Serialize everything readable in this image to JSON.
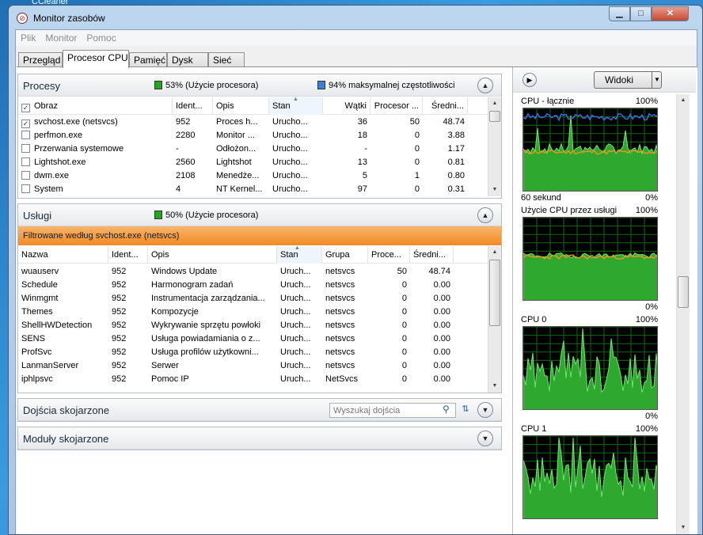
{
  "desktop_caption": "CCleaner",
  "window": {
    "title": "Monitor zasobów",
    "min_glyph": "▁",
    "max_glyph": "□",
    "close_glyph": "✕"
  },
  "menu": [
    "Plik",
    "Monitor",
    "Pomoc"
  ],
  "tabs": [
    "Przegląd",
    "Procesor CPU",
    "Pamięć",
    "Dysk",
    "Sieć"
  ],
  "active_tab": 1,
  "processes": {
    "title": "Procesy",
    "usage_text": "53% (Użycie procesora)",
    "max_freq_text": "94% maksymalnej częstotliwości",
    "usage_color": "#1fa81f",
    "freq_color": "#3b7fd9",
    "columns": [
      "Obraz",
      "Ident...",
      "Opis",
      "Stan",
      "Wątki",
      "Procesor ...",
      "Średni..."
    ],
    "rows": [
      {
        "checked": true,
        "name": "svchost.exe (netsvcs)",
        "pid": "952",
        "desc": "Proces h...",
        "state": "Urucho...",
        "threads": "36",
        "cpu": "50",
        "avg": "48.74"
      },
      {
        "checked": false,
        "name": "perfmon.exe",
        "pid": "2280",
        "desc": "Monitor ...",
        "state": "Urucho...",
        "threads": "18",
        "cpu": "0",
        "avg": "3.88"
      },
      {
        "checked": false,
        "name": "Przerwania systemowe",
        "pid": "-",
        "desc": "Odłożon...",
        "state": "Urucho...",
        "threads": "-",
        "cpu": "0",
        "avg": "1.17"
      },
      {
        "checked": false,
        "name": "Lightshot.exe",
        "pid": "2560",
        "desc": "Lightshot",
        "state": "Urucho...",
        "threads": "13",
        "cpu": "0",
        "avg": "0.81"
      },
      {
        "checked": false,
        "name": "dwm.exe",
        "pid": "2108",
        "desc": "Menedże...",
        "state": "Urucho...",
        "threads": "5",
        "cpu": "1",
        "avg": "0.80"
      },
      {
        "checked": false,
        "name": "System",
        "pid": "4",
        "desc": "NT Kernel...",
        "state": "Urucho...",
        "threads": "97",
        "cpu": "0",
        "avg": "0.31"
      }
    ]
  },
  "services": {
    "title": "Usługi",
    "usage_text": "50% (Użycie procesora)",
    "filter_text": "Filtrowane według svchost.exe (netsvcs)",
    "columns": [
      "Nazwa",
      "Ident...",
      "Opis",
      "Stan",
      "Grupa",
      "Proce...",
      "Średni..."
    ],
    "rows": [
      {
        "name": "wuauserv",
        "pid": "952",
        "desc": "Windows Update",
        "state": "Uruch...",
        "group": "netsvcs",
        "cpu": "50",
        "avg": "48.74"
      },
      {
        "name": "Schedule",
        "pid": "952",
        "desc": "Harmonogram zadań",
        "state": "Uruch...",
        "group": "netsvcs",
        "cpu": "0",
        "avg": "0.00"
      },
      {
        "name": "Winmgmt",
        "pid": "952",
        "desc": "Instrumentacja zarządzania...",
        "state": "Uruch...",
        "group": "netsvcs",
        "cpu": "0",
        "avg": "0.00"
      },
      {
        "name": "Themes",
        "pid": "952",
        "desc": "Kompozycje",
        "state": "Uruch...",
        "group": "netsvcs",
        "cpu": "0",
        "avg": "0.00"
      },
      {
        "name": "ShellHWDetection",
        "pid": "952",
        "desc": "Wykrywanie sprzętu powłoki",
        "state": "Uruch...",
        "group": "netsvcs",
        "cpu": "0",
        "avg": "0.00"
      },
      {
        "name": "SENS",
        "pid": "952",
        "desc": "Usługa powiadamiania o z...",
        "state": "Uruch...",
        "group": "netsvcs",
        "cpu": "0",
        "avg": "0.00"
      },
      {
        "name": "ProfSvc",
        "pid": "952",
        "desc": "Usługa profilów użytkowni...",
        "state": "Uruch...",
        "group": "netsvcs",
        "cpu": "0",
        "avg": "0.00"
      },
      {
        "name": "LanmanServer",
        "pid": "952",
        "desc": "Serwer",
        "state": "Uruch...",
        "group": "netsvcs",
        "cpu": "0",
        "avg": "0.00"
      },
      {
        "name": "iphlpsvc",
        "pid": "952",
        "desc": "Pomoc IP",
        "state": "Uruch...",
        "group": "NetSvcs",
        "cpu": "0",
        "avg": "0.00"
      }
    ]
  },
  "handles": {
    "title": "Dojścia skojarzone",
    "search_placeholder": "Wyszukaj dojścia"
  },
  "modules": {
    "title": "Moduły skojarzone"
  },
  "right_panel": {
    "views_label": "Widoki",
    "graphs": [
      {
        "title": "CPU - łącznie",
        "max_label": "100%",
        "foot_left": "60 sekund",
        "foot_right": "0%"
      },
      {
        "title": "Użycie CPU przez usługi",
        "max_label": "100%",
        "foot_left": "",
        "foot_right": "0%"
      },
      {
        "title": "CPU 0",
        "max_label": "100%",
        "foot_left": "",
        "foot_right": "0%"
      },
      {
        "title": "CPU 1",
        "max_label": "100%",
        "foot_left": "",
        "foot_right": ""
      }
    ]
  },
  "icons": {
    "collapse": "chevron-up-icon",
    "expand": "chevron-down-icon",
    "search": "search-icon",
    "refresh": "refresh-icon"
  }
}
